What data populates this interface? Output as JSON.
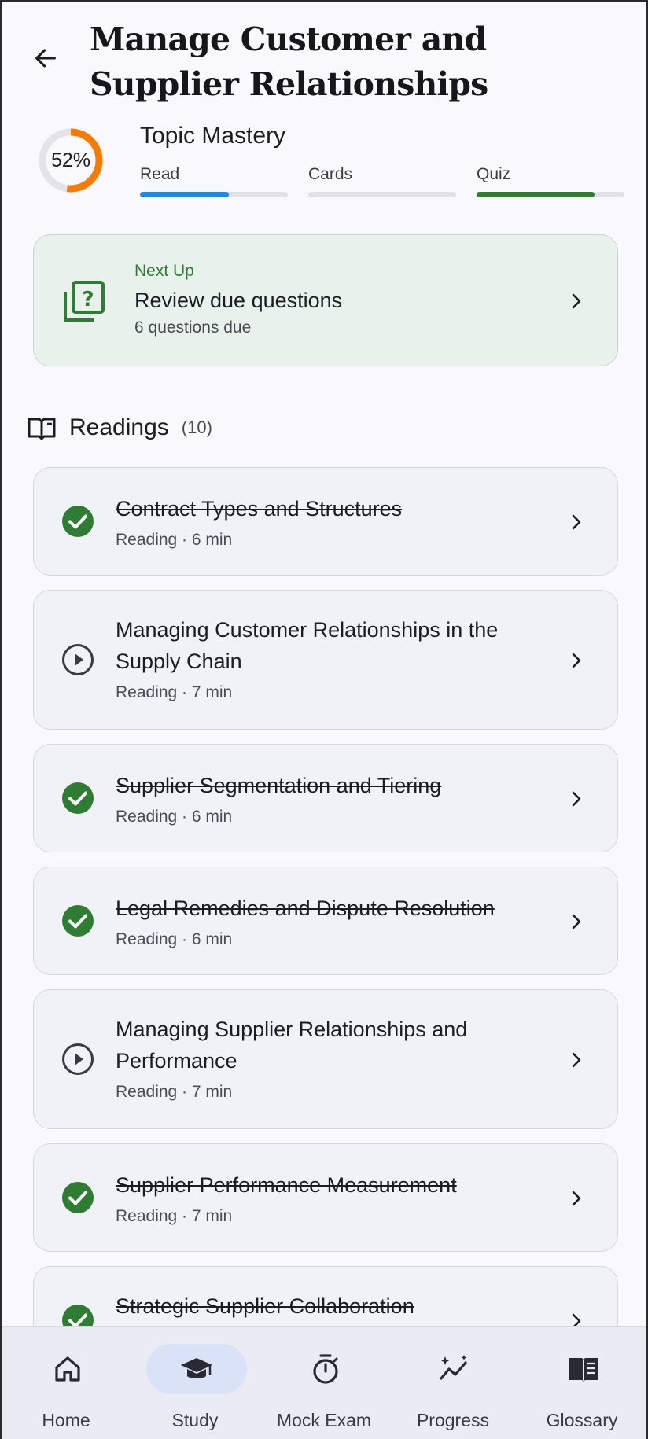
{
  "header": {
    "back_icon": "arrow-left-icon",
    "title": "Manage Customer and Supplier Relationships"
  },
  "mastery": {
    "percent_label": "52%",
    "percent_value": 52,
    "title": "Topic Mastery",
    "bars": [
      {
        "label": "Read",
        "progress": 0.6,
        "color": "#1e88e5"
      },
      {
        "label": "Cards",
        "progress": 0.0,
        "color": "#9e9e9e"
      },
      {
        "label": "Quiz",
        "progress": 0.8,
        "color": "#2e7d32"
      }
    ],
    "ring_color": "#f57c00",
    "ring_track_color": "#e3e3e8"
  },
  "next_up": {
    "icon": "quiz-question-icon",
    "eyebrow": "Next Up",
    "title": "Review due questions",
    "subtitle": "6 questions due"
  },
  "readings": {
    "icon": "open-book-icon",
    "title": "Readings",
    "count": "(10)",
    "items": [
      {
        "title": "Contract Types and Structures",
        "meta": "Reading · 6 min",
        "status": "completed"
      },
      {
        "title": "Managing Customer Relationships in the Supply Chain",
        "meta": "Reading · 7 min",
        "status": "not-started"
      },
      {
        "title": "Supplier Segmentation and Tiering",
        "meta": "Reading · 6 min",
        "status": "completed"
      },
      {
        "title": "Legal Remedies and Dispute Resolution",
        "meta": "Reading · 6 min",
        "status": "completed"
      },
      {
        "title": "Managing Supplier Relationships and Performance",
        "meta": "Reading · 7 min",
        "status": "not-started"
      },
      {
        "title": "Supplier Performance Measurement",
        "meta": "Reading · 7 min",
        "status": "completed"
      },
      {
        "title": "Strategic Supplier Collaboration",
        "meta": "",
        "status": "completed"
      }
    ]
  },
  "nav": {
    "items": [
      {
        "label": "Home",
        "icon": "home-icon",
        "active": false
      },
      {
        "label": "Study",
        "icon": "graduation-cap-icon",
        "active": true
      },
      {
        "label": "Mock Exam",
        "icon": "stopwatch-icon",
        "active": false
      },
      {
        "label": "Progress",
        "icon": "sparkle-trend-icon",
        "active": false
      },
      {
        "label": "Glossary",
        "icon": "book-icon",
        "active": false
      }
    ]
  },
  "colors": {
    "accent_green": "#2e7d32",
    "accent_blue": "#1e88e5",
    "next_card_bg": "#e8f1ec"
  }
}
